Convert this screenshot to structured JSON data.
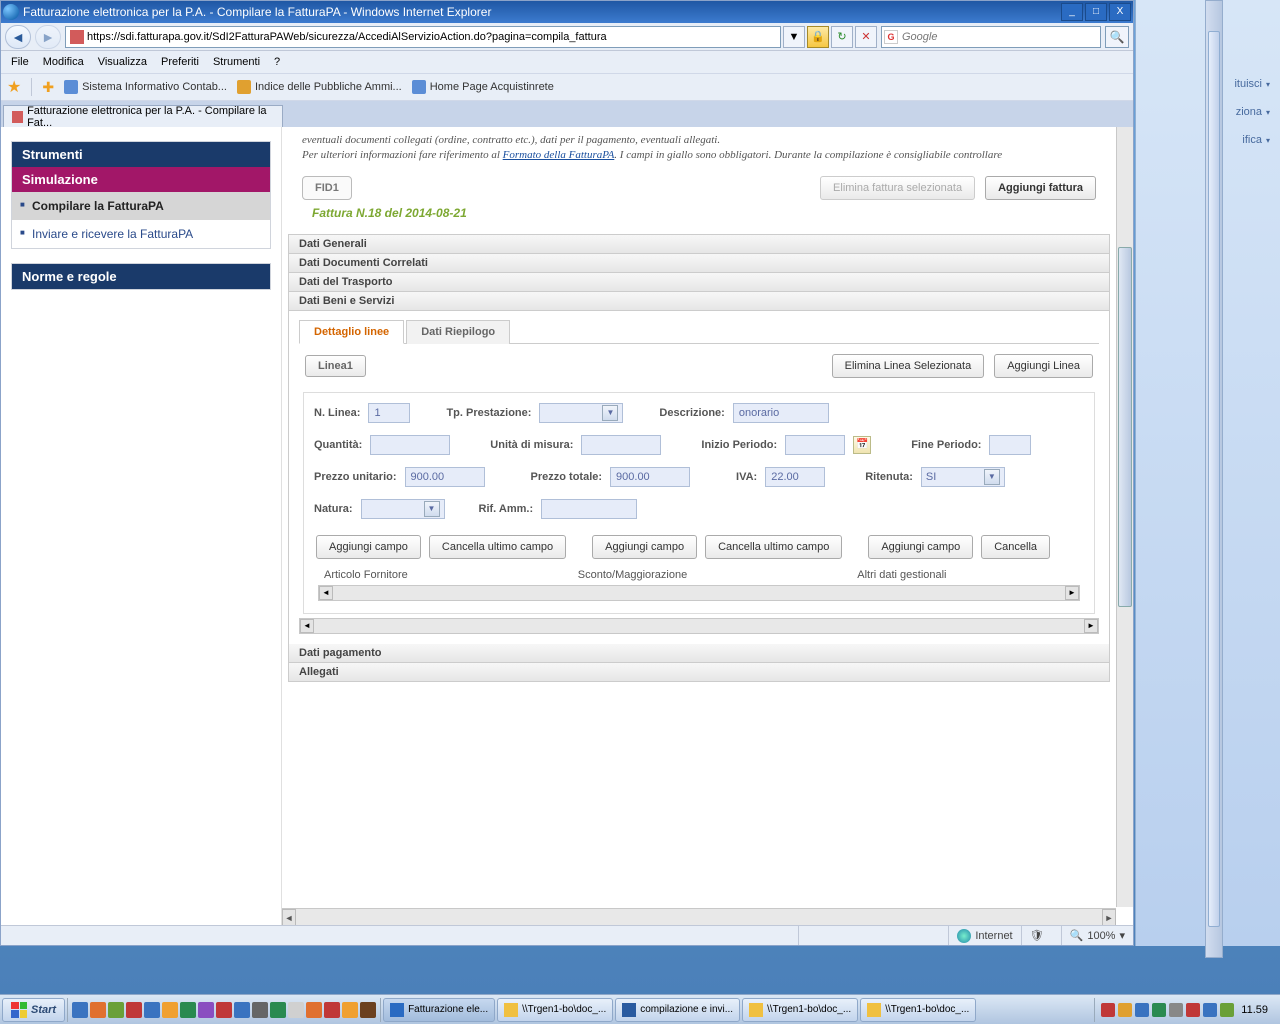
{
  "window": {
    "title": "Fatturazione elettronica per la P.A. - Compilare la FatturaPA - Windows Internet Explorer",
    "min": "_",
    "max": "□",
    "close": "X"
  },
  "nav": {
    "url": "https://sdi.fatturapa.gov.it/SdI2FatturaPAWeb/sicurezza/AccediAlServizioAction.do?pagina=compila_fattura",
    "search_placeholder": "Google"
  },
  "menu": [
    "File",
    "Modifica",
    "Visualizza",
    "Preferiti",
    "Strumenti",
    "?"
  ],
  "favorites": [
    {
      "label": "Sistema Informativo Contab..."
    },
    {
      "label": "Indice delle Pubbliche Ammi..."
    },
    {
      "label": "Home Page Acquistinrete"
    }
  ],
  "doc_tab": "Fatturazione elettronica per la P.A. - Compilare la Fat...",
  "sidebar": {
    "strumenti": "Strumenti",
    "simulazione": "Simulazione",
    "items": [
      {
        "label": "Compilare la FatturaPA",
        "active": true
      },
      {
        "label": "Inviare e ricevere la FatturaPA",
        "active": false
      }
    ],
    "norme": "Norme e regole"
  },
  "main": {
    "desc_line1": "eventuali documenti collegati (ordine, contratto etc.), dati per il pagamento, eventuali allegati.",
    "desc_line2a": "Per ulteriori informazioni fare riferimento al ",
    "desc_link": "Formato della FatturaPA",
    "desc_line2b": ". I campi in giallo sono obbligatori. Durante la compilazione è consigliabile controllare",
    "fid_tab": "FID1",
    "btn_elimina_fattura": "Elimina fattura selezionata",
    "btn_aggiungi_fattura": "Aggiungi fattura",
    "invoice_caption": "Fattura N.18 del 2014-08-21",
    "sections": {
      "generali": "Dati Generali",
      "correlati": "Dati Documenti Correlati",
      "trasporto": "Dati del Trasporto",
      "beni": "Dati Beni e Servizi",
      "pagamento": "Dati pagamento",
      "allegati": "Allegati"
    },
    "inner_tabs": {
      "dettaglio": "Dettaglio linee",
      "riepilogo": "Dati Riepilogo"
    },
    "linea_tab": "Linea1",
    "btn_elimina_linea": "Elimina Linea Selezionata",
    "btn_aggiungi_linea": "Aggiungi Linea",
    "labels": {
      "n_linea": "N. Linea:",
      "tp_prest": "Tp. Prestazione:",
      "descrizione": "Descrizione:",
      "quantita": "Quantità:",
      "udm": "Unità di misura:",
      "inizio": "Inizio Periodo:",
      "fine": "Fine Periodo:",
      "prezzo_u": "Prezzo unitario:",
      "prezzo_t": "Prezzo totale:",
      "iva": "IVA:",
      "ritenuta": "Ritenuta:",
      "natura": "Natura:",
      "rif": "Rif. Amm.:"
    },
    "values": {
      "n_linea": "1",
      "descrizione": "onorario",
      "prezzo_u": "900.00",
      "prezzo_t": "900.00",
      "iva": "22.00",
      "ritenuta": "SI"
    },
    "btn_aggiungi_campo": "Aggiungi campo",
    "btn_cancella_campo": "Cancella ultimo campo",
    "btn_cancella_short": "Cancella",
    "col_headers": {
      "art": "Articolo Fornitore",
      "sconto": "Sconto/Maggiorazione",
      "altri": "Altri dati gestionali"
    }
  },
  "status": {
    "zone": "Internet",
    "zoom": "100%"
  },
  "bg_right": {
    "opt1": "ituisci",
    "opt2": "ziona",
    "opt3": "ifica"
  },
  "taskbar": {
    "start": "Start",
    "items": [
      {
        "label": "Fatturazione ele...",
        "active": true,
        "color": "#2a6bc2"
      },
      {
        "label": "\\\\Trgen1-bo\\doc_...",
        "color": "#f0c040"
      },
      {
        "label": "compilazione e invi...",
        "color": "#2a5ba0"
      },
      {
        "label": "\\\\Trgen1-bo\\doc_...",
        "color": "#f0c040"
      },
      {
        "label": "\\\\Trgen1-bo\\doc_...",
        "color": "#f0c040"
      }
    ],
    "clock": "11.59"
  }
}
